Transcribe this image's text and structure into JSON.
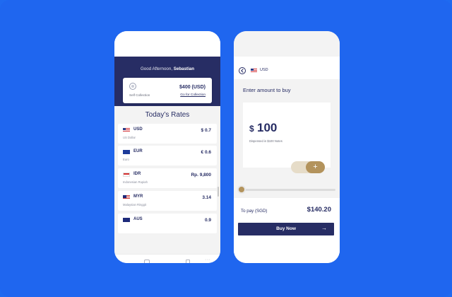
{
  "colors": {
    "background": "#1f6af0",
    "navy": "#272d64",
    "gold": "#b3935c",
    "gold_light": "#e6dcc8"
  },
  "home": {
    "greeting_prefix": "Good Afternoon,",
    "user_name": "Sebastian",
    "collection": {
      "label": "Self Collection",
      "amount": "$400 (USD)",
      "link": "Go for Collection"
    },
    "rates_title": "Today’s Rates",
    "rates": [
      {
        "code": "USD",
        "name": "US Dollar",
        "value": "$ 0.7",
        "flag": "us-flag-icon"
      },
      {
        "code": "EUR",
        "name": "Euro",
        "value": "€ 0.6",
        "flag": "eu-flag-icon"
      },
      {
        "code": "IDR",
        "name": "Indonesian Rupiah",
        "value": "Rp. 9,800",
        "flag": "id-flag-icon"
      },
      {
        "code": "MYR",
        "name": "Malaysian Ringgit",
        "value": "3.14",
        "flag": "my-flag-icon"
      },
      {
        "code": "AUS",
        "name": "",
        "value": "0.9",
        "flag": "au-flag-icon"
      }
    ],
    "nav": {
      "more": "···"
    }
  },
  "buy": {
    "currency": "USD",
    "prompt": "Enter amount to buy",
    "amount_symbol": "$",
    "amount": "100",
    "note": "Dispensed in $100 Notes",
    "stepper_plus": "+",
    "slider_level": 0.0,
    "pay_label": "To pay (SGD)",
    "pay_amount": "$140.20",
    "buy_button": "Buy Now",
    "buy_arrow": "→"
  }
}
